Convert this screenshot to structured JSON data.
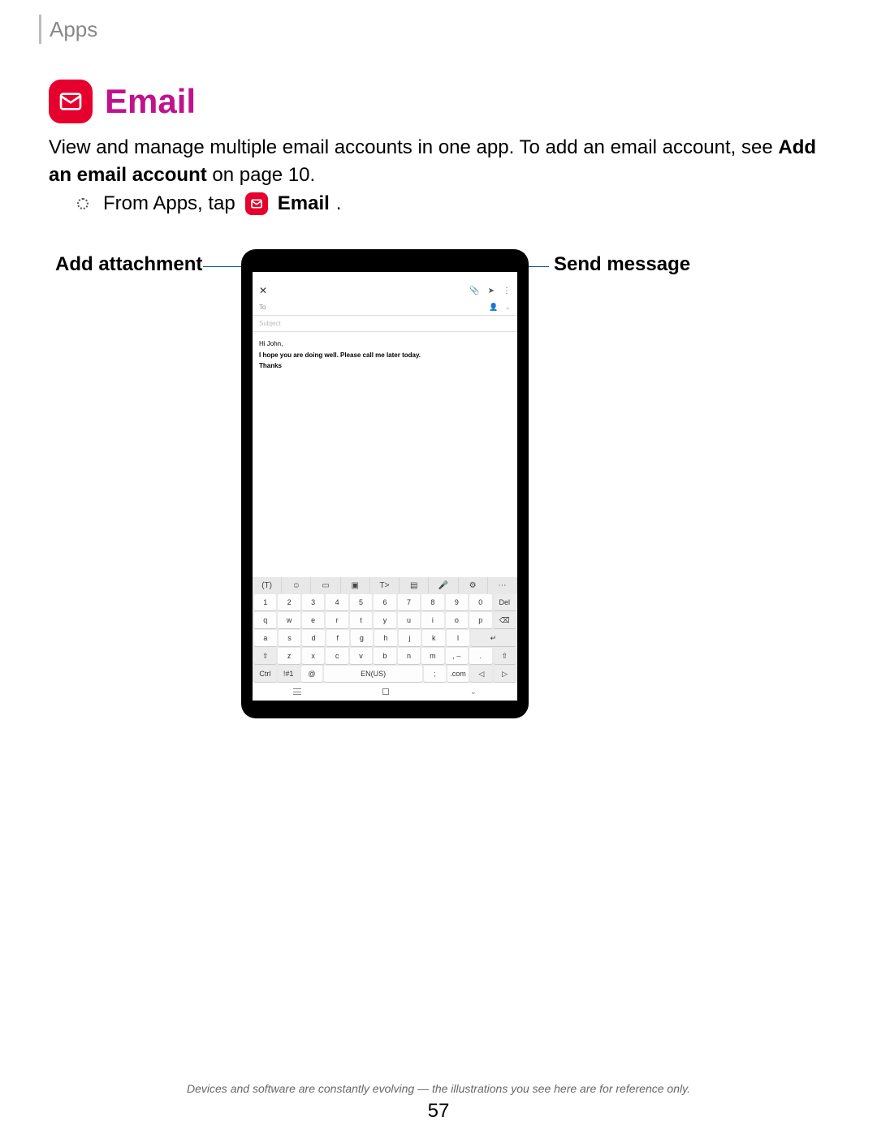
{
  "breadcrumb": "Apps",
  "section": {
    "title": "Email",
    "intro_1": "View and manage multiple email accounts in one app. To add an email account, see ",
    "intro_bold": "Add an email account",
    "intro_2": " on page 10.",
    "step_prefix": "From Apps, tap ",
    "step_app": "Email",
    "step_suffix": "."
  },
  "callouts": {
    "left": "Add attachment",
    "right": "Send message"
  },
  "screen": {
    "close": "✕",
    "attach_icon": "📎",
    "send_icon": "➤",
    "more_icon": "⋮",
    "to_label": "To",
    "to_contact_icon": "👤",
    "to_expand_icon": "⌄",
    "subject_placeholder": "Subject",
    "body_greeting": "Hi John,",
    "body_line": "I hope you are doing well. Please call me later today.",
    "body_signoff": "Thanks"
  },
  "keyboard": {
    "toolbar": [
      "(T)",
      "☺",
      "▭",
      "▣",
      "T>",
      "▤",
      "🎤",
      "⚙",
      "⋯"
    ],
    "row1": [
      "1",
      "2",
      "3",
      "4",
      "5",
      "6",
      "7",
      "8",
      "9",
      "0",
      "Del"
    ],
    "row2": [
      "q",
      "w",
      "e",
      "r",
      "t",
      "y",
      "u",
      "i",
      "o",
      "p",
      "⌫"
    ],
    "row3": [
      "a",
      "s",
      "d",
      "f",
      "g",
      "h",
      "j",
      "k",
      "l",
      "↵"
    ],
    "row4": [
      "⇧",
      "z",
      "x",
      "c",
      "v",
      "b",
      "n",
      "m",
      ", –",
      ".",
      "⇧"
    ],
    "row5": [
      "Ctrl",
      "!#1",
      "@",
      "EN(US)",
      ";",
      ".com",
      "◁",
      "▷"
    ]
  },
  "footer": {
    "disclaimer": "Devices and software are constantly evolving — the illustrations you see here are for reference only.",
    "page": "57"
  }
}
